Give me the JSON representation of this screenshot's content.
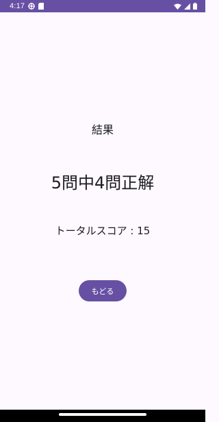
{
  "status_bar": {
    "time": "4:17",
    "background": "#6750a4",
    "icons_left": [
      "settings-icon",
      "sim-card-icon"
    ],
    "icons_right": [
      "wifi-icon",
      "signal-icon",
      "battery-icon"
    ]
  },
  "main": {
    "result_label": "結果",
    "correct_count": "5問中4問正解",
    "total_score": "トータルスコア : 15",
    "back_button_label": "もどる",
    "accent_color": "#6750a4"
  }
}
